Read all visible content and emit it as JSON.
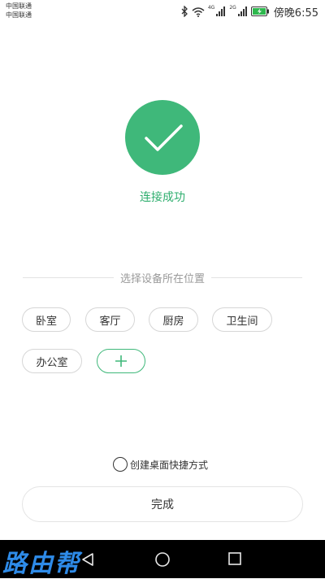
{
  "status_bar": {
    "carrier1": "中国联通",
    "carrier2": "中国联通",
    "net1": "4G",
    "net2": "2G",
    "time": "傍晚6:55"
  },
  "success": {
    "message": "连接成功",
    "icon": "check-icon",
    "color": "#3fb87a"
  },
  "location": {
    "label": "选择设备所在位置",
    "rooms": [
      "卧室",
      "客厅",
      "厨房",
      "卫生间",
      "办公室"
    ],
    "add_icon": "plus-icon"
  },
  "shortcut": {
    "label": "创建桌面快捷方式",
    "checked": false
  },
  "done_button": {
    "label": "完成"
  },
  "watermark": {
    "text": "路由帮"
  },
  "nav_bar": {
    "icons": [
      "back-icon",
      "home-icon",
      "recent-apps-icon"
    ]
  }
}
